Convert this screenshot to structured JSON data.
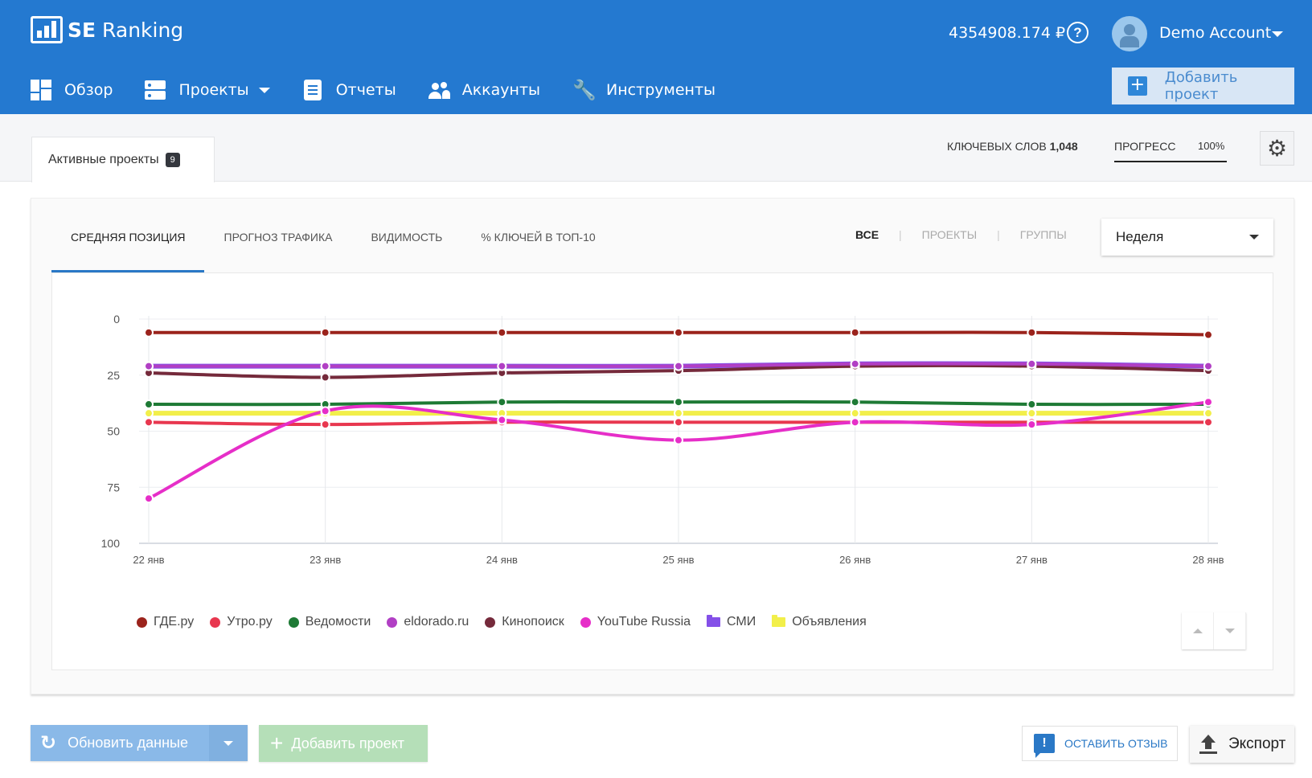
{
  "header": {
    "logo_text_bold": "SE",
    "logo_text": "Ranking",
    "balance": "4354908.174 ₽",
    "help_icon": "question-circle-icon",
    "account_name": "Demo Account",
    "add_project_label": "Добавить проект"
  },
  "nav": {
    "items": [
      {
        "label": "Обзор",
        "icon": "dashboard-grid-icon"
      },
      {
        "label": "Проекты",
        "icon": "projects-icon",
        "has_dropdown": true
      },
      {
        "label": "Отчеты",
        "icon": "report-icon"
      },
      {
        "label": "Аккаунты",
        "icon": "users-icon"
      },
      {
        "label": "Инструменты",
        "icon": "wrench-icon"
      }
    ]
  },
  "subbar": {
    "tab_label": "Активные проекты",
    "tab_count": "9",
    "keywords_label": "КЛЮЧЕВЫХ СЛОВ",
    "keywords_value": "1,048",
    "progress_label": "ПРОГРЕСС",
    "progress_value": "100%"
  },
  "card": {
    "tabs": [
      {
        "label": "СРЕДНЯЯ ПОЗИЦИЯ",
        "active": true
      },
      {
        "label": "ПРОГНОЗ ТРАФИКА",
        "active": false
      },
      {
        "label": "ВИДИМОСТЬ",
        "active": false
      },
      {
        "label": "% КЛЮЧЕЙ В ТОП-10",
        "active": false
      }
    ],
    "filters": [
      {
        "label": "ВСЕ",
        "active": true
      },
      {
        "label": "ПРОЕКТЫ",
        "active": false
      },
      {
        "label": "ГРУППЫ",
        "active": false
      }
    ],
    "period_selected": "Неделя"
  },
  "chart_data": {
    "type": "line",
    "title": "",
    "xlabel": "",
    "ylabel": "",
    "y_inverted": true,
    "ylim": [
      0,
      100
    ],
    "yticks": [
      "0",
      "25",
      "50",
      "75",
      "100"
    ],
    "grid": true,
    "legend_position": "bottom-left",
    "x": [
      "22 янв",
      "23 янв",
      "24 янв",
      "25 янв",
      "26 янв",
      "27 янв",
      "28 янв"
    ],
    "series": [
      {
        "name": "ГДЕ.ру",
        "color": "#9b231c",
        "marker": "dot",
        "values": [
          6,
          6,
          6,
          6,
          6,
          6,
          7
        ]
      },
      {
        "name": "Утро.ру",
        "color": "#e8374f",
        "marker": "dot",
        "values": [
          46,
          47,
          46,
          46,
          46,
          46,
          46
        ]
      },
      {
        "name": "Ведомости",
        "color": "#1e7a35",
        "marker": "dot",
        "values": [
          38,
          38,
          37,
          37,
          37,
          38,
          38
        ]
      },
      {
        "name": "eldorado.ru",
        "color": "#b13fc4",
        "marker": "dot",
        "values": [
          21,
          21,
          21,
          21,
          20,
          20,
          21
        ]
      },
      {
        "name": "Кинопоиск",
        "color": "#752a3b",
        "marker": "dot",
        "values": [
          24,
          26,
          24,
          23,
          21,
          21,
          23
        ]
      },
      {
        "name": "YouTube Russia",
        "color": "#e62ec8",
        "marker": "dot",
        "values": [
          80,
          41,
          45,
          54,
          46,
          47,
          37
        ]
      },
      {
        "name": "СМИ",
        "color": "#8450e8",
        "marker": "folder",
        "values": [
          21,
          21,
          21,
          21,
          20,
          20,
          21
        ]
      },
      {
        "name": "Объявления",
        "color": "#f2ef4a",
        "marker": "folder",
        "values": [
          42,
          42,
          42,
          42,
          42,
          42,
          42
        ]
      }
    ]
  },
  "footer": {
    "refresh_label": "Обновить данные",
    "add_project_label": "Добавить проект",
    "feedback_label": "ОСТАВИТЬ ОТЗЫВ",
    "export_label": "Экспорт"
  }
}
